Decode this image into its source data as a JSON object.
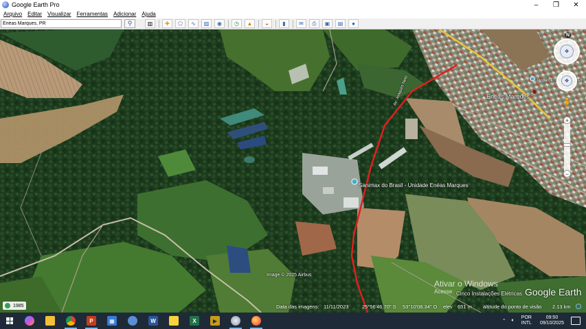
{
  "window": {
    "title": "Google Earth Pro",
    "controls": [
      "–",
      "❐",
      "✕"
    ]
  },
  "menu": [
    "Arquivo",
    "Editar",
    "Visualizar",
    "Ferramentas",
    "Adicionar",
    "Ajuda"
  ],
  "search": {
    "value": "Enéas Marques, PR",
    "button_icon": "search-icon"
  },
  "toolbar_icons": [
    "sidebar-icon",
    "placemark-icon",
    "polygon-icon",
    "path-icon",
    "image-overlay-icon",
    "record-tour-icon",
    "historical-imagery-icon",
    "sunlight-icon",
    "planets-icon",
    "ruler-icon",
    "email-icon",
    "print-icon",
    "save-image-icon",
    "maps-icon",
    "earth-icon"
  ],
  "map": {
    "labels": {
      "town": "Enéas Marques",
      "factory": "Sanimax do Brasil - Unidade Enéas Marques",
      "road": "Av. Joaquim Neto",
      "partial_poi": "Coparoli",
      "partial_poi2": "Pro",
      "business": "Cinco Instalações Elétricas",
      "attribution": "Image © 2025 Airbus"
    },
    "watermark": "Ativar o Windows",
    "watermark_sub": "Acesse",
    "logo": "Google Earth",
    "history_year": "1985",
    "status": {
      "imagery_date_label": "Data das imagens:",
      "imagery_date": "11/11/2023",
      "lat": "25°56'46.70\" S",
      "lon": "53°10'08.34\" O",
      "elev_label": "elev",
      "elev": "651 m",
      "eye_label": "altitude do ponto de visão",
      "eye_alt": "2.13 km"
    },
    "north_label": "N"
  },
  "taskbar": {
    "apps": [
      {
        "name": "copilot",
        "glyph": "✦",
        "color": "#7a5af8"
      },
      {
        "name": "file-explorer",
        "glyph": "▀",
        "color": "#f2c037"
      },
      {
        "name": "chrome",
        "glyph": "●",
        "color": "#db4437"
      },
      {
        "name": "powerpoint",
        "glyph": "P",
        "color": "#c43e1c"
      },
      {
        "name": "calculator",
        "glyph": "▦",
        "color": "#3a7bd5"
      },
      {
        "name": "app-blue-swirl",
        "glyph": "◐",
        "color": "#5a8fd6"
      },
      {
        "name": "word",
        "glyph": "W",
        "color": "#2b579a"
      },
      {
        "name": "sticky-notes",
        "glyph": "■",
        "color": "#f7d43b"
      },
      {
        "name": "excel",
        "glyph": "X",
        "color": "#217346"
      },
      {
        "name": "media-player",
        "glyph": "▶",
        "color": "#c79a1a"
      },
      {
        "name": "google-earth",
        "glyph": "◉",
        "color": "#9aa5b1"
      },
      {
        "name": "firefox",
        "glyph": "●",
        "color": "#ff7139"
      }
    ],
    "tray": {
      "lang1": "POR",
      "lang2": "INTL",
      "time": "09:50",
      "date": "09/10/2025"
    }
  }
}
